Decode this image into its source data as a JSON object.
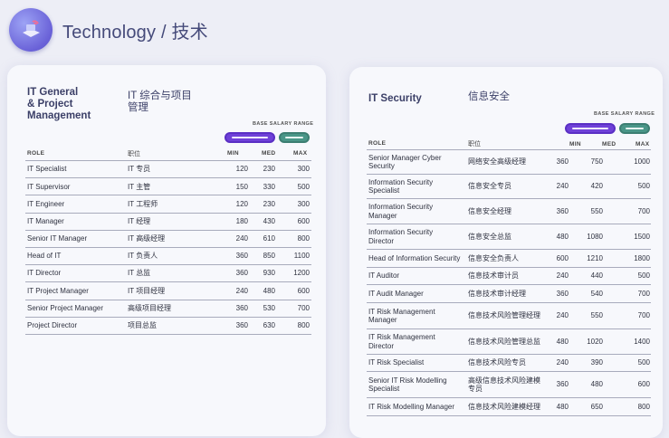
{
  "page": {
    "title": "Technology / 技术"
  },
  "range_label": "BASE SALARY RANGE",
  "columns": {
    "role": "ROLE",
    "role_cn": "职位",
    "min": "MIN",
    "med": "MED",
    "max": "MAX"
  },
  "left": {
    "title_en": "IT General\n& Project\nManagement",
    "title_cn": "IT 综合与项目\n管理",
    "rows": [
      {
        "role": "IT Specialist",
        "cn": "IT 专员",
        "min": "120",
        "med": "230",
        "max": "300"
      },
      {
        "role": "IT Supervisor",
        "cn": "IT 主管",
        "min": "150",
        "med": "330",
        "max": "500"
      },
      {
        "role": "IT Engineer",
        "cn": "IT 工程师",
        "min": "120",
        "med": "230",
        "max": "300"
      },
      {
        "role": "IT Manager",
        "cn": "IT 经理",
        "min": "180",
        "med": "430",
        "max": "600"
      },
      {
        "role": "Senior IT Manager",
        "cn": "IT 高级经理",
        "min": "240",
        "med": "610",
        "max": "800"
      },
      {
        "role": "Head of IT",
        "cn": "IT 负责人",
        "min": "360",
        "med": "850",
        "max": "1100"
      },
      {
        "role": "IT Director",
        "cn": "IT 总监",
        "min": "360",
        "med": "930",
        "max": "1200"
      },
      {
        "role": "IT Project Manager",
        "cn": "IT 项目经理",
        "min": "240",
        "med": "480",
        "max": "600"
      },
      {
        "role": "Senior Project Manager",
        "cn": "高级项目经理",
        "min": "360",
        "med": "530",
        "max": "700"
      },
      {
        "role": "Project Director",
        "cn": "项目总监",
        "min": "360",
        "med": "630",
        "max": "800"
      }
    ]
  },
  "right": {
    "title_en": "IT Security",
    "title_cn": "信息安全",
    "rows": [
      {
        "role": "Senior Manager Cyber\nSecurity",
        "cn": "网络安全高级经理",
        "min": "360",
        "med": "750",
        "max": "1000",
        "h": 26
      },
      {
        "role": "Information Security\nSpecialist",
        "cn": "信息安全专员",
        "min": "240",
        "med": "420",
        "max": "500",
        "h": 26
      },
      {
        "role": "Information Security\nManager",
        "cn": "信息安全经理",
        "min": "360",
        "med": "550",
        "max": "700",
        "h": 27
      },
      {
        "role": "Information Security\nDirector",
        "cn": "信息安全总监",
        "min": "480",
        "med": "1080",
        "max": "1500",
        "h": 27
      },
      {
        "role": "Head of Information Security",
        "cn": "信息安全负责人",
        "min": "600",
        "med": "1210",
        "max": "1800",
        "h": 19
      },
      {
        "role": "IT Auditor",
        "cn": "信息技术审计员",
        "min": "240",
        "med": "440",
        "max": "500",
        "h": 18
      },
      {
        "role": "IT Audit Manager",
        "cn": "信息技术审计经理",
        "min": "360",
        "med": "540",
        "max": "700",
        "h": 19
      },
      {
        "role": "IT Risk Management\nManager",
        "cn": "信息技术风险管理经理",
        "min": "240",
        "med": "550",
        "max": "700",
        "h": 28
      },
      {
        "role": "IT Risk Management\nDirector",
        "cn": "信息技术风险管理总监",
        "min": "480",
        "med": "1020",
        "max": "1400",
        "h": 27
      },
      {
        "role": "IT Risk Specialist",
        "cn": "信息技术风险专员",
        "min": "240",
        "med": "390",
        "max": "500",
        "h": 18
      },
      {
        "role": "Senior IT Risk Modelling\nSpecialist",
        "cn": "高级信息技术风险建模\n专员",
        "min": "360",
        "med": "480",
        "max": "600",
        "h": 28
      },
      {
        "role": "IT Risk Modelling Manager",
        "cn": "信息技术风险建模经理",
        "min": "480",
        "med": "650",
        "max": "800",
        "h": 19
      }
    ]
  }
}
